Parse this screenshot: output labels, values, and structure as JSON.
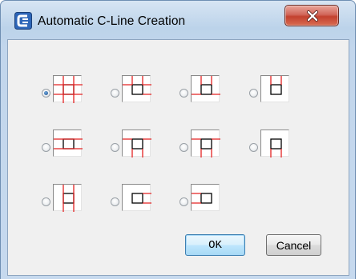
{
  "window": {
    "title": "Automatic C-Line Creation",
    "app_icon": "c-line-app-icon",
    "close_icon": "close-icon"
  },
  "options": [
    {
      "id": "full-grid",
      "icon": "cline-full-grid-icon",
      "selected": true
    },
    {
      "id": "top-left-corner",
      "icon": "cline-corner-top-left-icon",
      "selected": false
    },
    {
      "id": "top-two-sides",
      "icon": "cline-top-two-icon",
      "selected": false
    },
    {
      "id": "top-vertical-only",
      "icon": "cline-top-vertical-icon",
      "selected": false
    },
    {
      "id": "horizontal-through",
      "icon": "cline-horizontal-through-icon",
      "selected": false
    },
    {
      "id": "left-corner-down",
      "icon": "cline-left-corner-down-icon",
      "selected": false
    },
    {
      "id": "two-vertical-down",
      "icon": "cline-two-vertical-down-icon",
      "selected": false
    },
    {
      "id": "vertical-down-only",
      "icon": "cline-vertical-down-icon",
      "selected": false
    },
    {
      "id": "vertical-through",
      "icon": "cline-vertical-through-icon",
      "selected": false
    },
    {
      "id": "horizontal-right",
      "icon": "cline-horizontal-right-icon",
      "selected": false
    },
    {
      "id": "horizontal-left",
      "icon": "cline-horizontal-left-icon",
      "selected": false
    }
  ],
  "buttons": {
    "ok_label": "OK",
    "cancel_label": "Cancel"
  },
  "colors": {
    "cline": "#e32222",
    "outline": "#000000",
    "radio_selected": "#1d4f8a"
  }
}
